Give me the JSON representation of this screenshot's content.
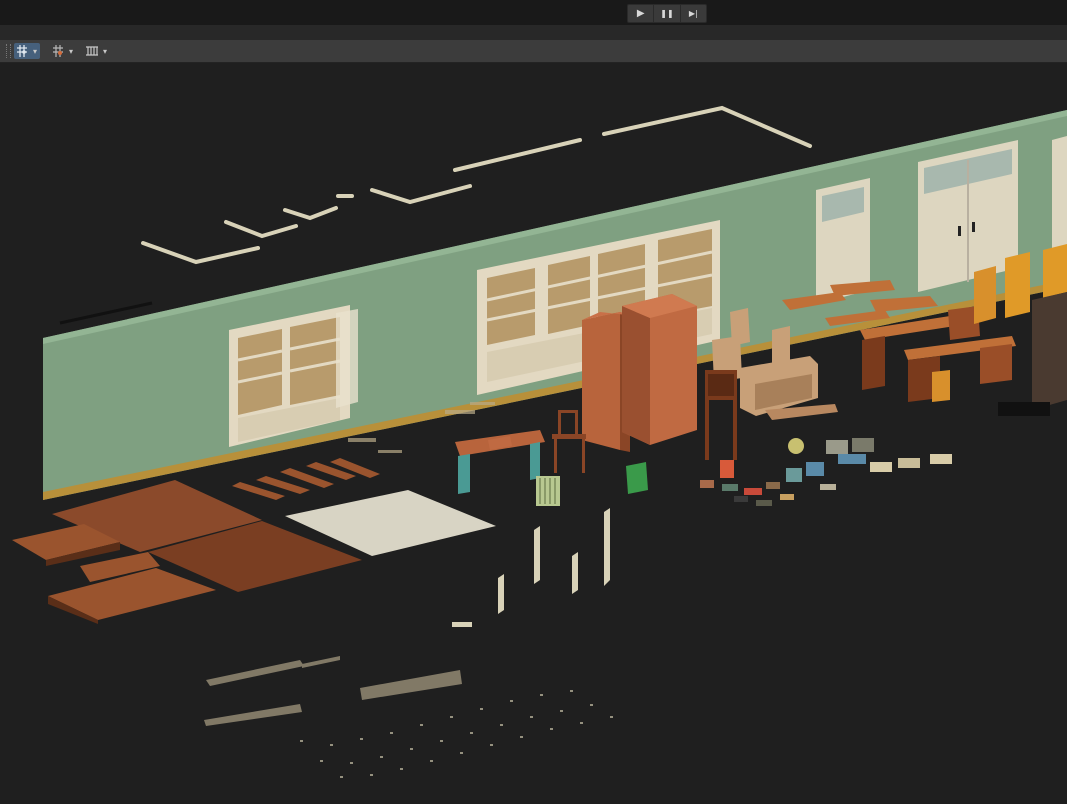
{
  "playback": {
    "play_icon": "▶",
    "pause_icon": "❚❚",
    "step_icon": "▶|"
  },
  "toolbar": {
    "tools": [
      {
        "icon": "grid-snap-icon",
        "active": true
      },
      {
        "icon": "snap-settings-icon",
        "active": false
      },
      {
        "icon": "ruler-grid-icon",
        "active": false
      }
    ],
    "caret": "▾"
  },
  "colors": {
    "wall": "#7fa081",
    "wall_shadow": "#5f7f62",
    "floor_wood": "#8b4a2b",
    "cabinet": "#e3d9c2",
    "wardrobe": "#b8643c",
    "toolbar": "#3c3c3c",
    "accent": "#46607c"
  }
}
